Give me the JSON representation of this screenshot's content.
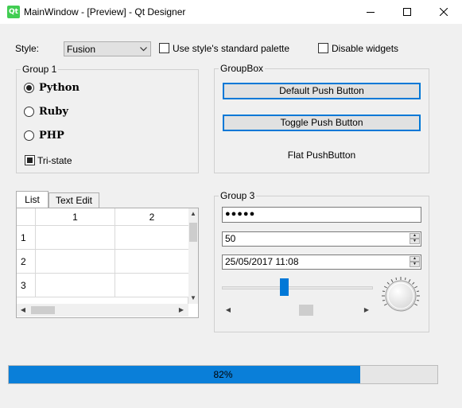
{
  "window": {
    "app_icon_text": "Qt",
    "title": "MainWindow - [Preview] - Qt Designer",
    "minimize_icon": "minimize-icon",
    "maximize_icon": "maximize-icon",
    "close_icon": "close-icon"
  },
  "toolbar": {
    "style_label": "Style:",
    "style_value": "Fusion",
    "standard_palette_label": "Use style's standard palette",
    "standard_palette_checked": false,
    "disable_widgets_label": "Disable widgets",
    "disable_widgets_checked": false
  },
  "group1": {
    "title": "Group 1",
    "radios": [
      {
        "label": "Python",
        "checked": true
      },
      {
        "label": "Ruby",
        "checked": false
      },
      {
        "label": "PHP",
        "checked": false
      }
    ],
    "tristate_label": "Tri-state",
    "tristate_state": "partial"
  },
  "groupbox": {
    "title": "GroupBox",
    "default_button": "Default Push Button",
    "toggle_button": "Toggle Push Button",
    "flat_button": "Flat PushButton"
  },
  "tabs": {
    "items": [
      {
        "label": "List",
        "active": true
      },
      {
        "label": "Text Edit",
        "active": false
      }
    ],
    "columns": [
      "1",
      "2"
    ],
    "rows": [
      "1",
      "2",
      "3"
    ]
  },
  "group3": {
    "title": "Group 3",
    "password": "●●●●●",
    "spin_value": "50",
    "datetime_value": "25/05/2017 11:08",
    "slider_value": 0.5,
    "scrollbar_value": 0.5
  },
  "progress": {
    "value": 0.82,
    "text": "82%",
    "fill_color": "#06b025"
  }
}
